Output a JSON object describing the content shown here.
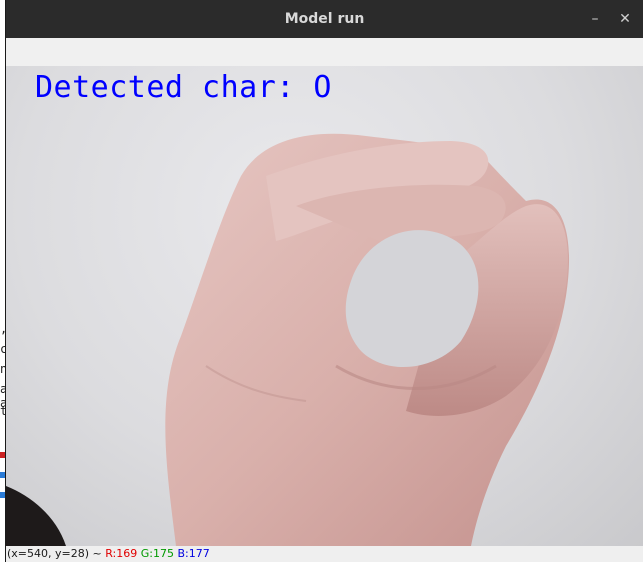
{
  "window": {
    "title": "Model run",
    "minimize_glyph": "–",
    "close_glyph": "✕"
  },
  "overlay": {
    "text": "Detected char: O",
    "color": "#0000ff"
  },
  "status": {
    "coords": "(x=540, y=28) ~",
    "r_label": "R:169",
    "g_label": "G:175",
    "b_label": "B:177"
  },
  "background_editor": {
    "chars": [
      ",",
      "c",
      "n",
      "a",
      "a",
      "t"
    ]
  }
}
